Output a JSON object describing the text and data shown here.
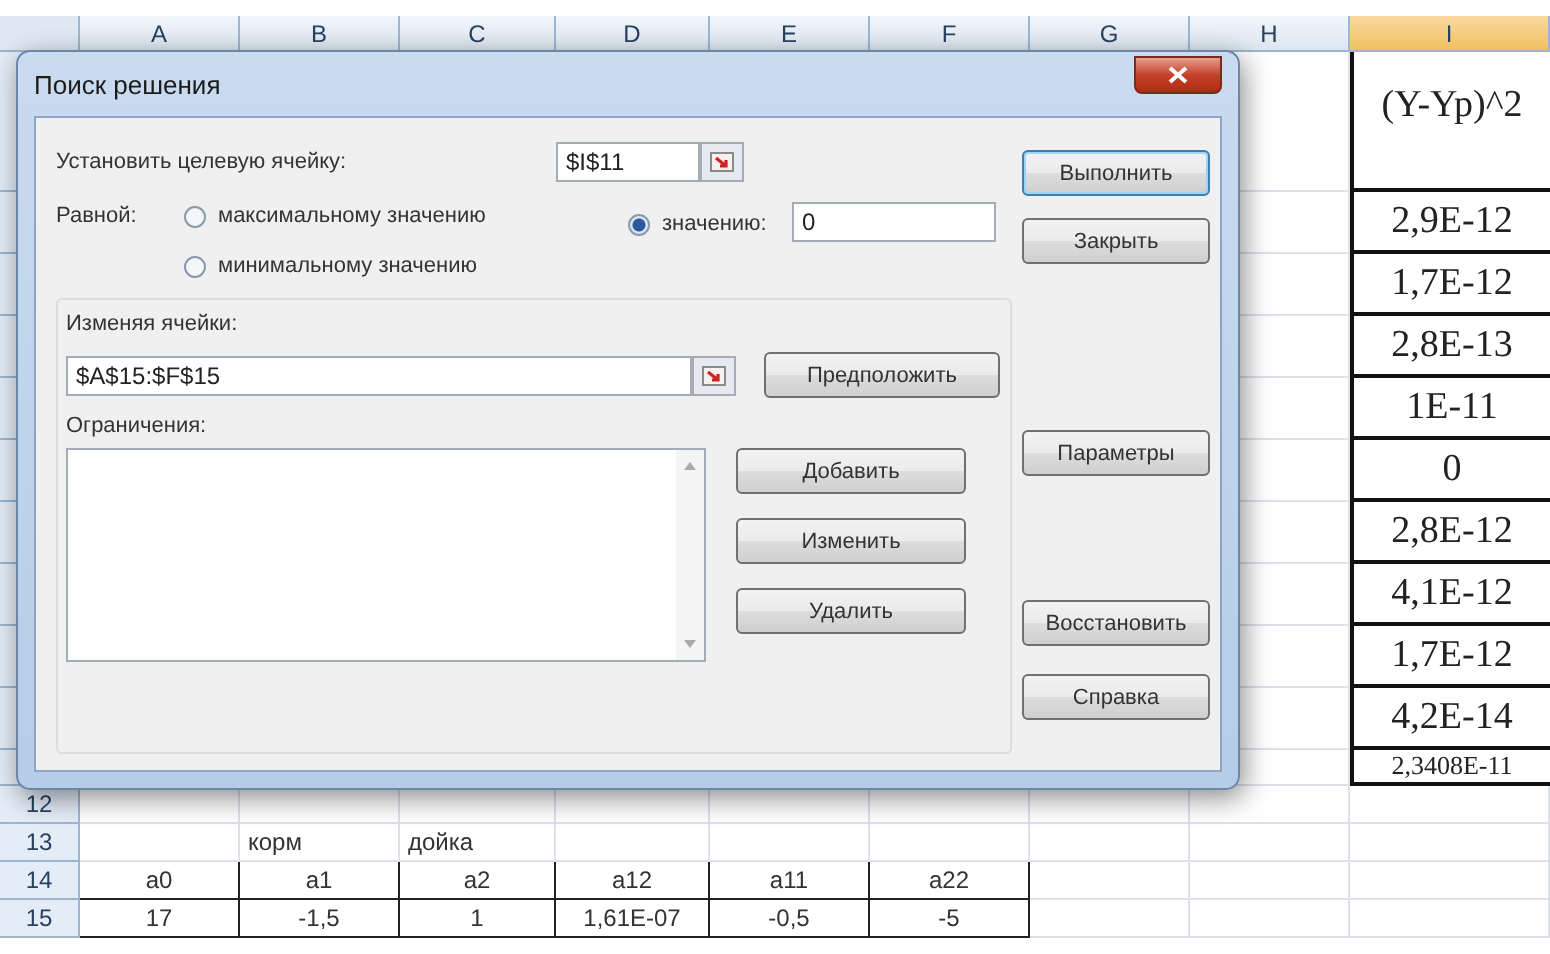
{
  "sheet": {
    "column_headers": [
      {
        "label": "A",
        "selected": false
      },
      {
        "label": "B",
        "selected": false
      },
      {
        "label": "C",
        "selected": false
      },
      {
        "label": "D",
        "selected": false
      },
      {
        "label": "E",
        "selected": false
      },
      {
        "label": "F",
        "selected": false
      },
      {
        "label": "G",
        "selected": false
      },
      {
        "label": "H",
        "selected": false
      },
      {
        "label": "I",
        "selected": true
      }
    ],
    "column_i": {
      "header": "(Y-Yp)^2",
      "values": [
        "2,9E-12",
        "1,7E-12",
        "2,8E-13",
        "1E-11",
        "0",
        "2,8E-12",
        "4,1E-12",
        "1,7E-12",
        "4,2E-14"
      ],
      "total": "2,3408E-11"
    },
    "rows": [
      {
        "number": "12",
        "kind": "plain",
        "cells": []
      },
      {
        "number": "13",
        "kind": "plain",
        "cells": [
          null,
          "корм",
          "дойка"
        ]
      },
      {
        "number": "14",
        "kind": "boxed",
        "cells": [
          "a0",
          "a1",
          "a2",
          "a12",
          "a11",
          "a22"
        ]
      },
      {
        "number": "15",
        "kind": "boxed",
        "cells": [
          "17",
          "-1,5",
          "1",
          "1,61E-07",
          "-0,5",
          "-5"
        ]
      }
    ]
  },
  "dialog": {
    "title": "Поиск решения",
    "target": {
      "label": "Установить целевую ячейку:",
      "value": "$I$11"
    },
    "equal_label": "Равной:",
    "options": [
      {
        "label": "максимальному значению",
        "selected": false
      },
      {
        "label": "значению:",
        "selected": true
      },
      {
        "label": "минимальному значению",
        "selected": false
      }
    ],
    "value_field": "0",
    "changing": {
      "label": "Изменяя ячейки:",
      "value": "$A$15:$F$15",
      "button": "Предположить"
    },
    "constraints": {
      "label": "Ограничения:",
      "buttons": [
        "Добавить",
        "Изменить",
        "Удалить"
      ]
    },
    "side_buttons": [
      {
        "label": "Выполнить",
        "default": true
      },
      {
        "label": "Закрыть",
        "default": false
      },
      {
        "label": "Параметры",
        "default": false
      },
      {
        "label": "Восстановить",
        "default": false
      },
      {
        "label": "Справка",
        "default": false
      }
    ]
  }
}
